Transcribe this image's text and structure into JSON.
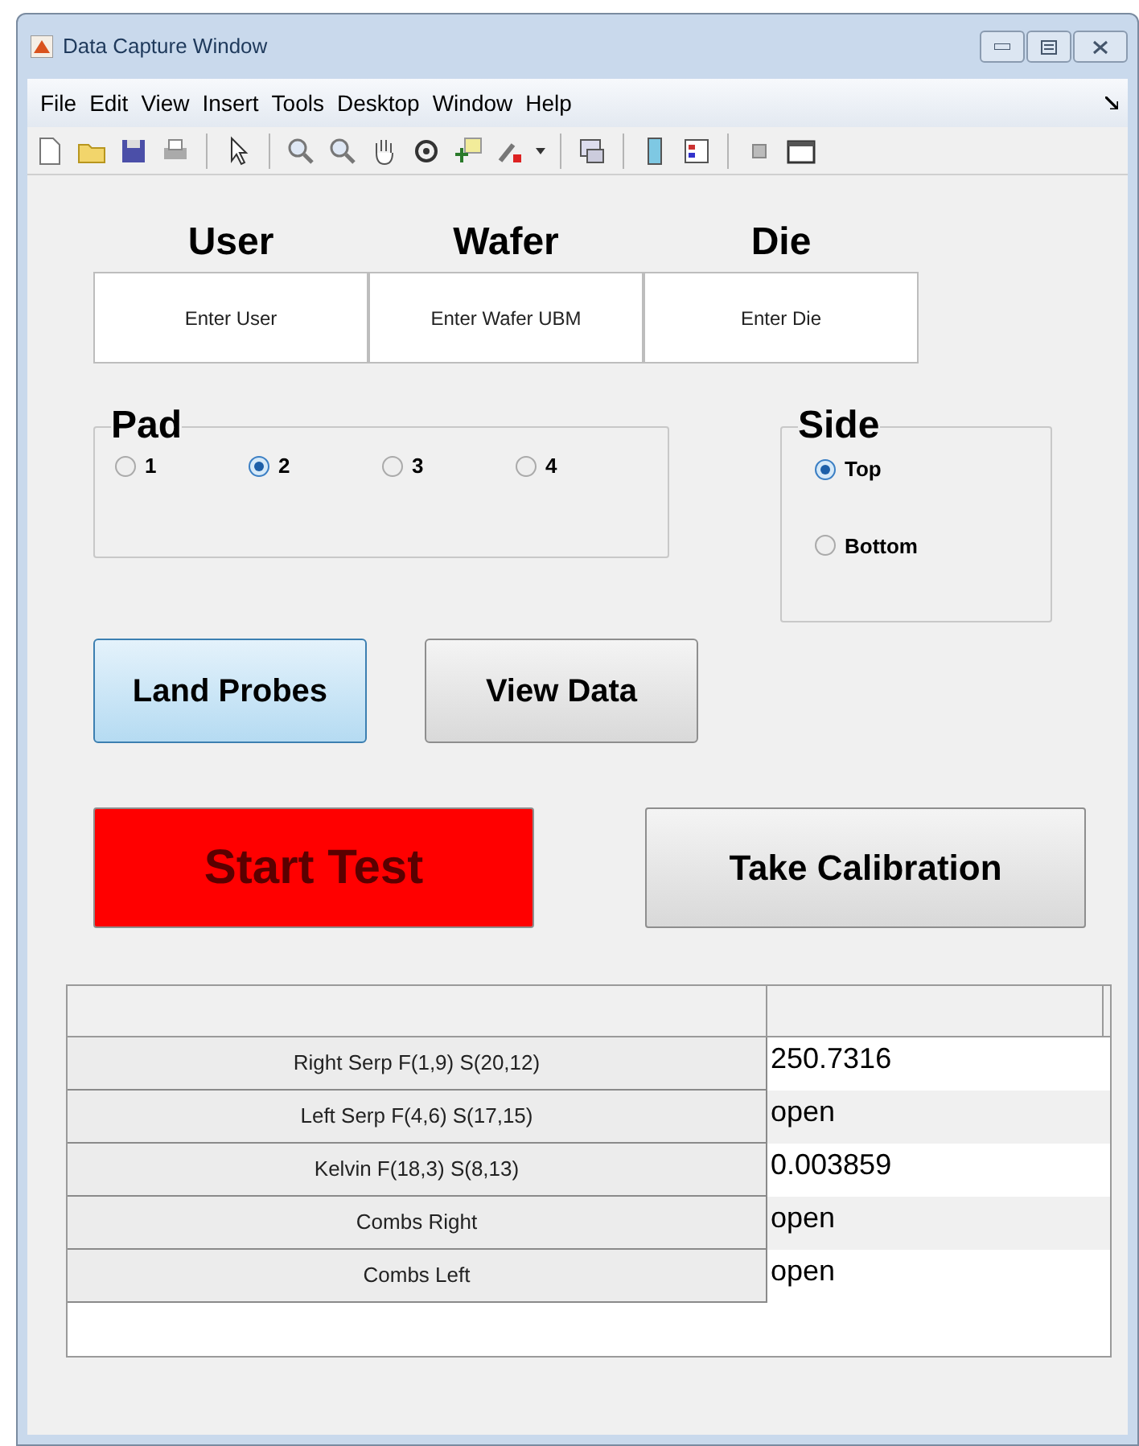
{
  "window": {
    "title": "Data Capture Window"
  },
  "menu": [
    "File",
    "Edit",
    "View",
    "Insert",
    "Tools",
    "Desktop",
    "Window",
    "Help"
  ],
  "fields": [
    {
      "label": "User",
      "value": "Enter User"
    },
    {
      "label": "Wafer",
      "value": "Enter Wafer UBM"
    },
    {
      "label": "Die",
      "value": "Enter Die"
    }
  ],
  "pad": {
    "title": "Pad",
    "options": [
      {
        "label": "1",
        "selected": false
      },
      {
        "label": "2",
        "selected": true
      },
      {
        "label": "3",
        "selected": false
      },
      {
        "label": "4",
        "selected": false
      }
    ]
  },
  "side": {
    "title": "Side",
    "options": [
      {
        "label": "Top",
        "selected": true
      },
      {
        "label": "Bottom",
        "selected": false
      }
    ]
  },
  "buttons": [
    {
      "label": "Land Probes",
      "kind": "focused"
    },
    {
      "label": "View Data",
      "kind": "normal"
    }
  ],
  "actions": [
    {
      "label": "Start Test",
      "kind": "alert"
    },
    {
      "label": "Take Calibration",
      "kind": "normal"
    }
  ],
  "table": {
    "rows": [
      {
        "label": "Right Serp F(1,9) S(20,12)",
        "value": "250.7316"
      },
      {
        "label": "Left Serp F(4,6) S(17,15)",
        "value": "open"
      },
      {
        "label": "Kelvin F(18,3) S(8,13)",
        "value": "0.003859"
      },
      {
        "label": "Combs Right",
        "value": "open"
      },
      {
        "label": "Combs Left",
        "value": "open"
      }
    ]
  }
}
